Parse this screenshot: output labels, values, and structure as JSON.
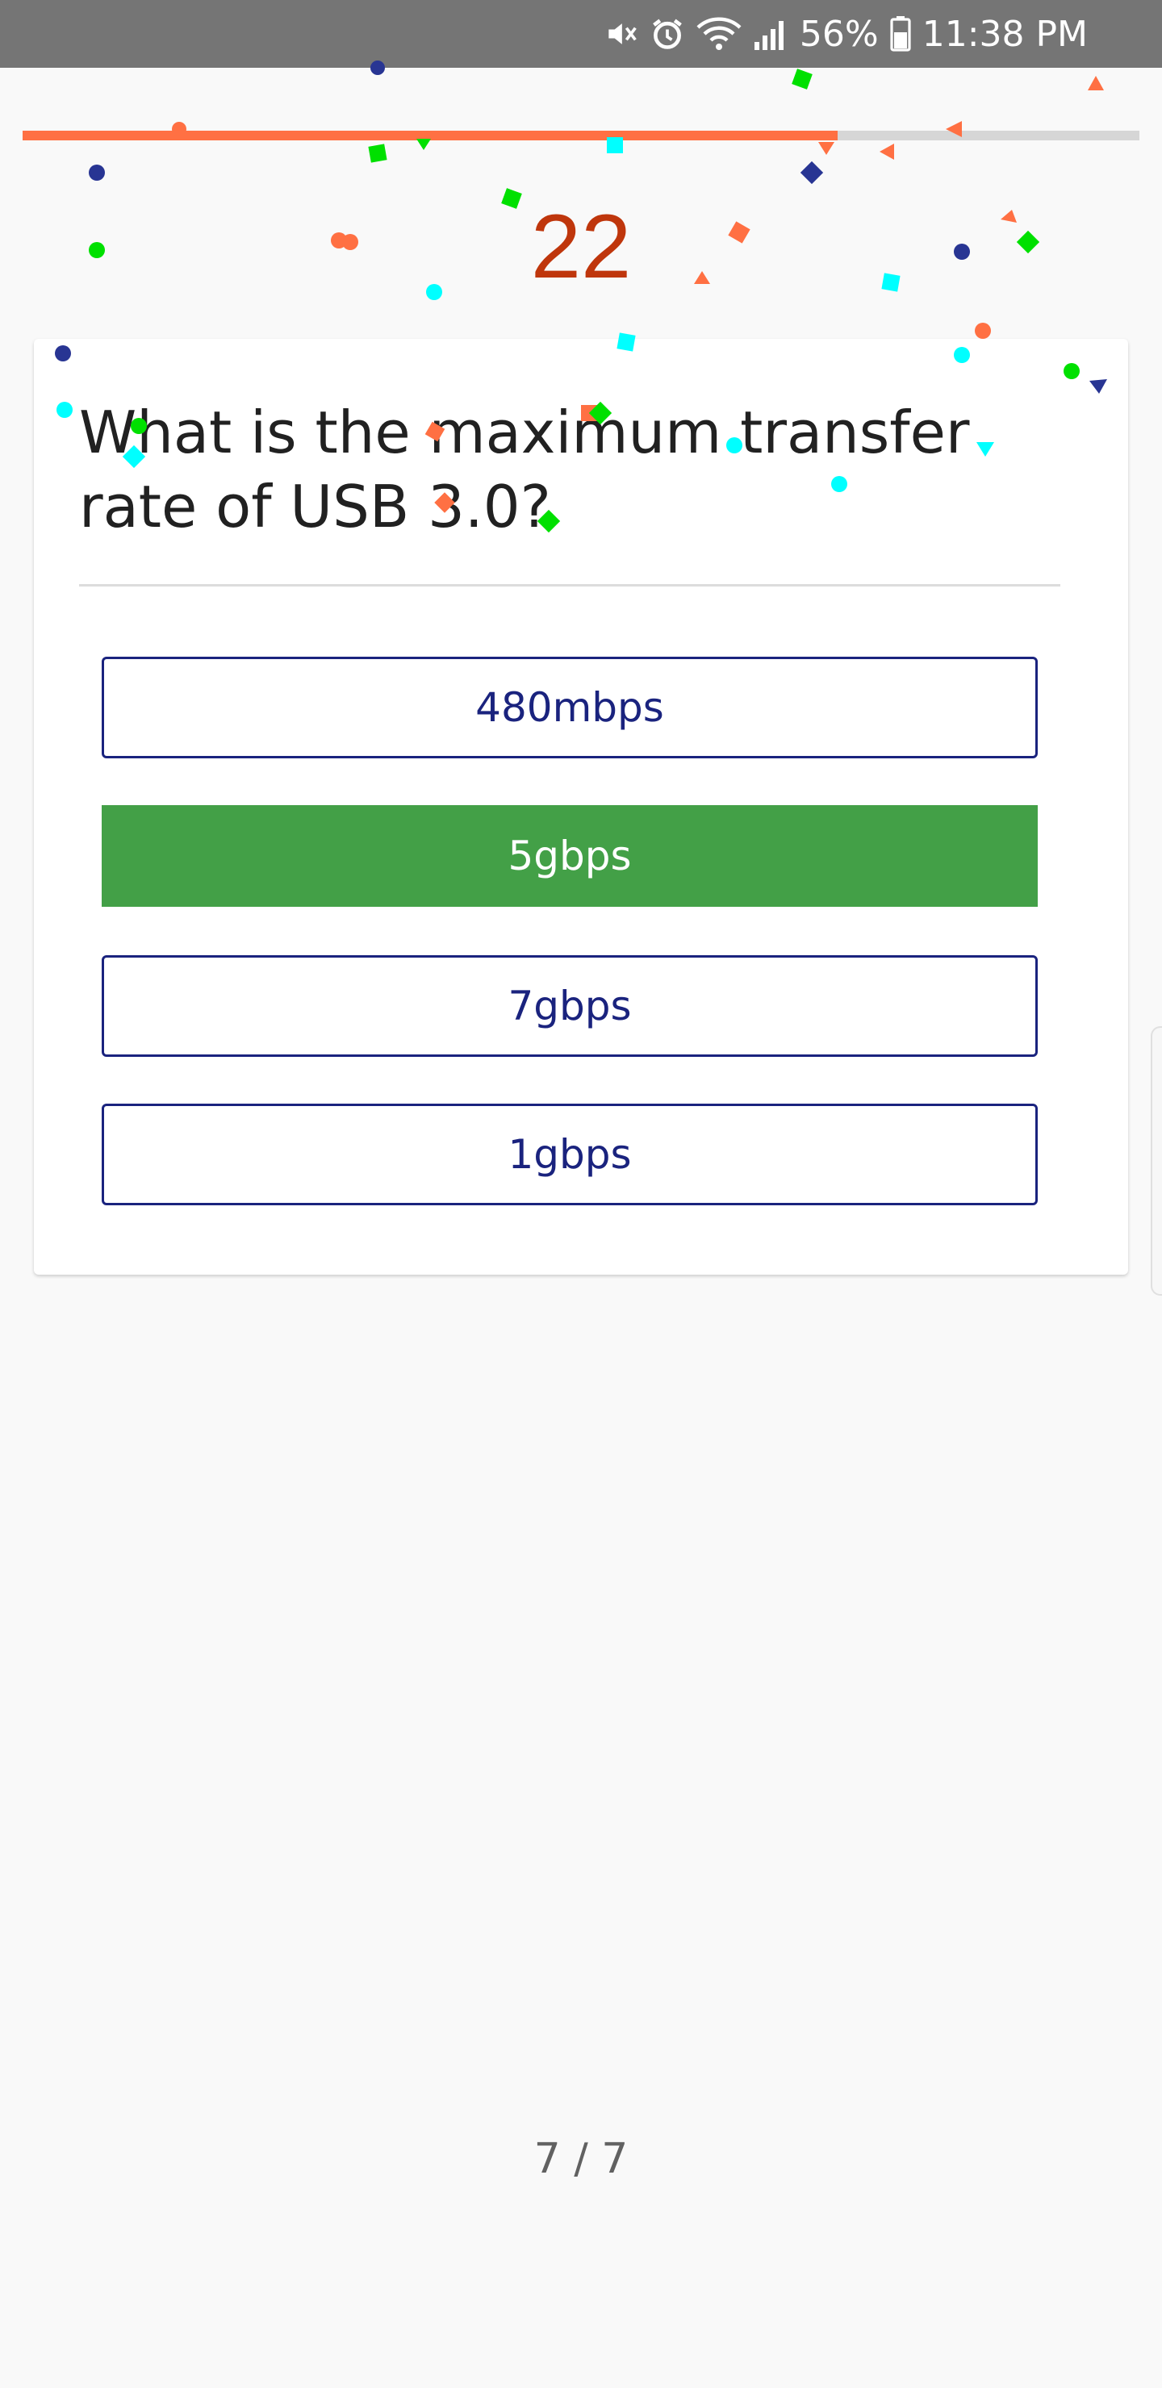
{
  "status_bar": {
    "battery": "56%",
    "time": "11:38 PM",
    "icons": [
      "mute-icon",
      "alarm-icon",
      "wifi-icon",
      "signal-icon",
      "battery-icon"
    ]
  },
  "quiz": {
    "progress": 0.73,
    "timer": "22",
    "question": "What is the maximum transfer rate of USB 3.0?",
    "options": [
      {
        "label": "480mbps",
        "state": "default"
      },
      {
        "label": "5gbps",
        "state": "correct"
      },
      {
        "label": "7gbps",
        "state": "default"
      },
      {
        "label": "1gbps",
        "state": "default"
      }
    ],
    "page_counter": "7 / 7"
  },
  "colors": {
    "accent": "#ff7043",
    "timer": "#bf360c",
    "option_border": "#1a237e",
    "correct": "#43a047",
    "confetti": [
      "#ff7043",
      "#00ff00",
      "#00ffff",
      "#283593"
    ]
  }
}
